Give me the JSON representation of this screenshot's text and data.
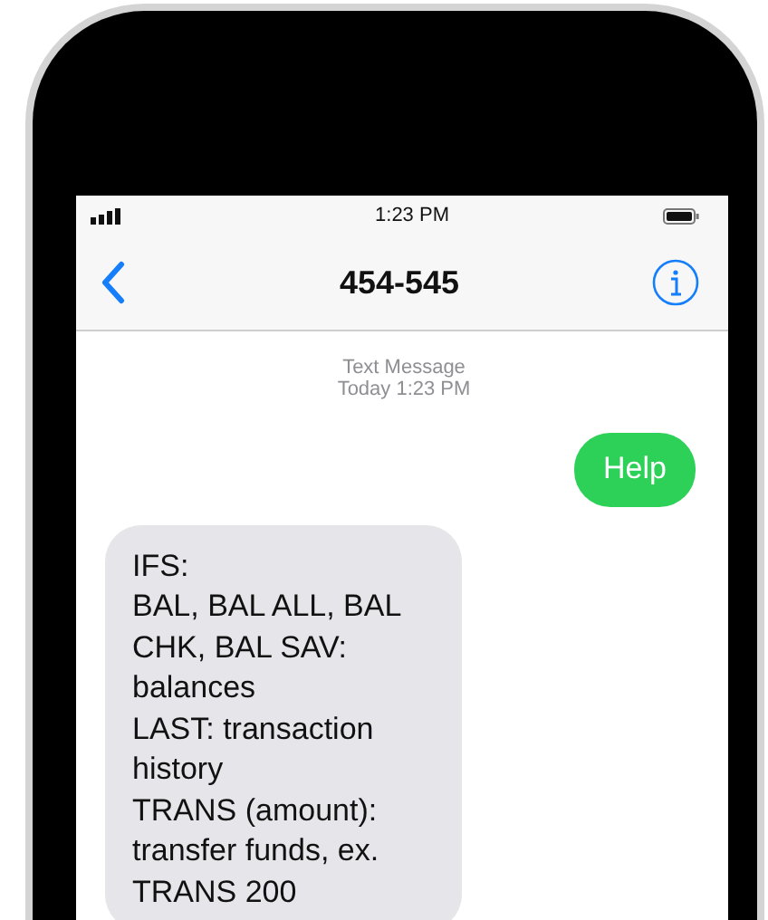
{
  "status_bar": {
    "time": "1:23 PM"
  },
  "nav_bar": {
    "title": "454-545"
  },
  "conversation": {
    "header": {
      "label": "Text Message",
      "time": "Today 1:23 PM"
    },
    "messages": [
      {
        "kind": "sent",
        "text": "Help"
      },
      {
        "kind": "received",
        "text": "IFS:\nBAL, BAL ALL, BAL CHK, BAL SAV: balances\nLAST: transaction history\nTRANS (amount): transfer funds, ex. TRANS 200"
      }
    ]
  }
}
